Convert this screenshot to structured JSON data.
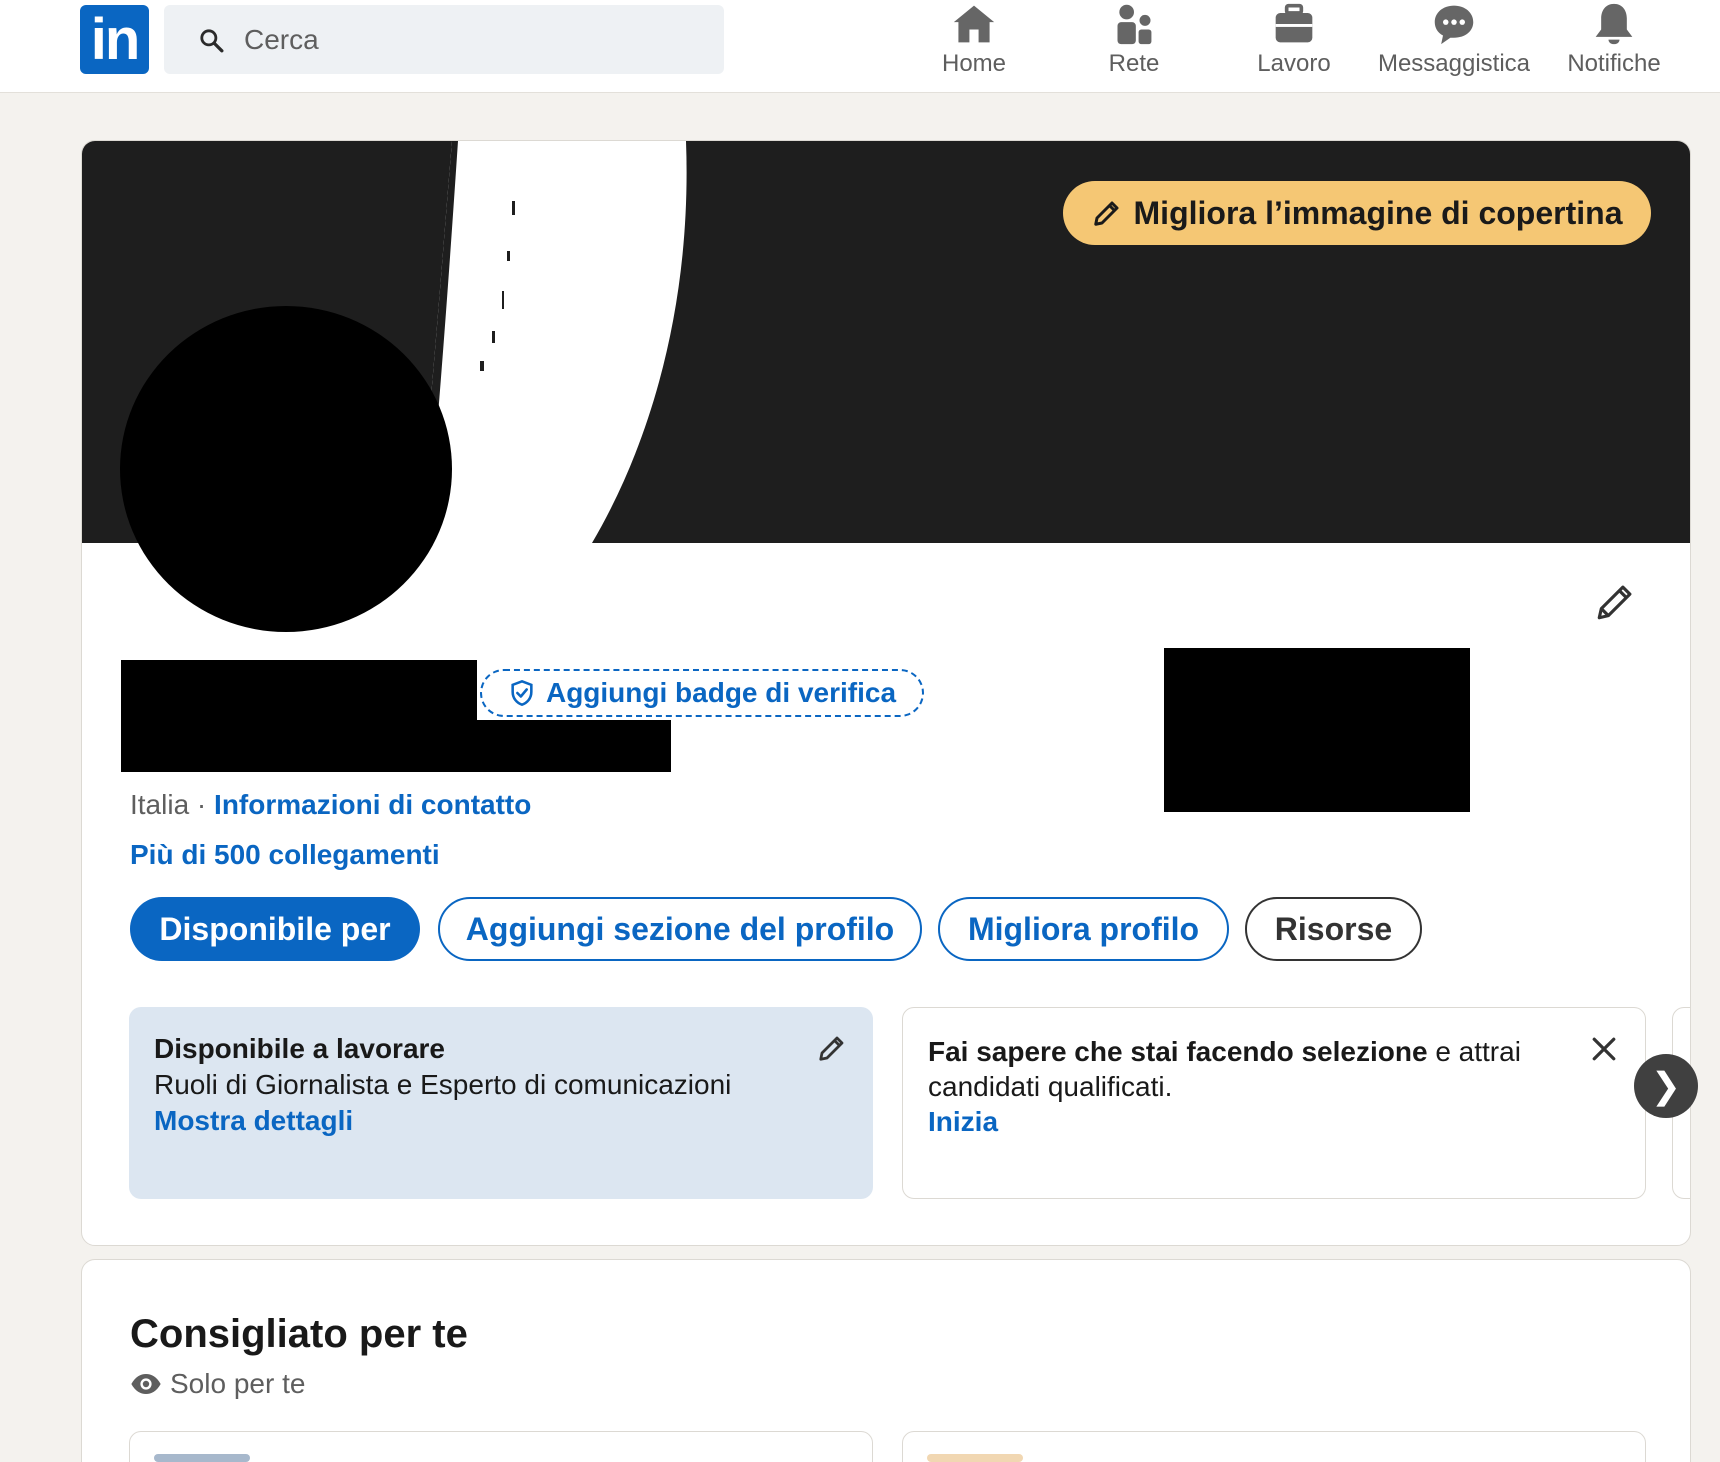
{
  "nav": {
    "logo": "in",
    "search_placeholder": "Cerca",
    "items": [
      {
        "label": "Home",
        "icon": "home-icon"
      },
      {
        "label": "Rete",
        "icon": "network-icon"
      },
      {
        "label": "Lavoro",
        "icon": "briefcase-icon"
      },
      {
        "label": "Messaggistica",
        "icon": "messaging-icon"
      },
      {
        "label": "Notifiche",
        "icon": "bell-icon"
      }
    ]
  },
  "profile": {
    "cover_button": "Migliora l’immagine di copertina",
    "verify_badge": "Aggiungi badge di verifica",
    "location": "Italia",
    "separator": " · ",
    "contact_info": "Informazioni di contatto",
    "connections": "Più di 500 collegamenti",
    "buttons": {
      "open_to": "Disponibile per",
      "add_section": "Aggiungi sezione del profilo",
      "improve": "Migliora profilo",
      "resources": "Risorse"
    },
    "open_to_work": {
      "title": "Disponibile a lavorare",
      "roles": "Ruoli di Giornalista e Esperto di comunicazioni",
      "link": "Mostra dettagli"
    },
    "hiring": {
      "bold": "Fai sapere che stai facendo selezione",
      "rest": " e attrai candidati qualificati.",
      "link": "Inizia"
    },
    "next_arrow": "❯"
  },
  "recommended": {
    "title": "Consigliato per te",
    "subtitle": "Solo per te"
  },
  "colors": {
    "brand": "#0a66c2",
    "cover_button": "#f5c774",
    "open_to_work_bg": "#dce6f1",
    "page_bg": "#f4f2ee"
  }
}
